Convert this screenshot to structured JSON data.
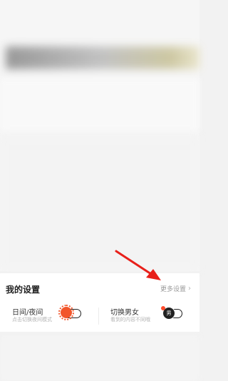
{
  "settings": {
    "title": "我的设置",
    "more_link": "更多设置",
    "more_chevron": "›",
    "items": [
      {
        "label": "日间/夜间",
        "subtitle": "点击切换夜间模式",
        "icon": "sun-toggle-icon"
      },
      {
        "label": "切换男女",
        "subtitle": "看到的内容不同哦",
        "icon": "gender-toggle-icon",
        "icon_letter": "男"
      }
    ]
  },
  "colors": {
    "accent_red": "#e8201a",
    "toggle_orange": "#f2562b"
  }
}
